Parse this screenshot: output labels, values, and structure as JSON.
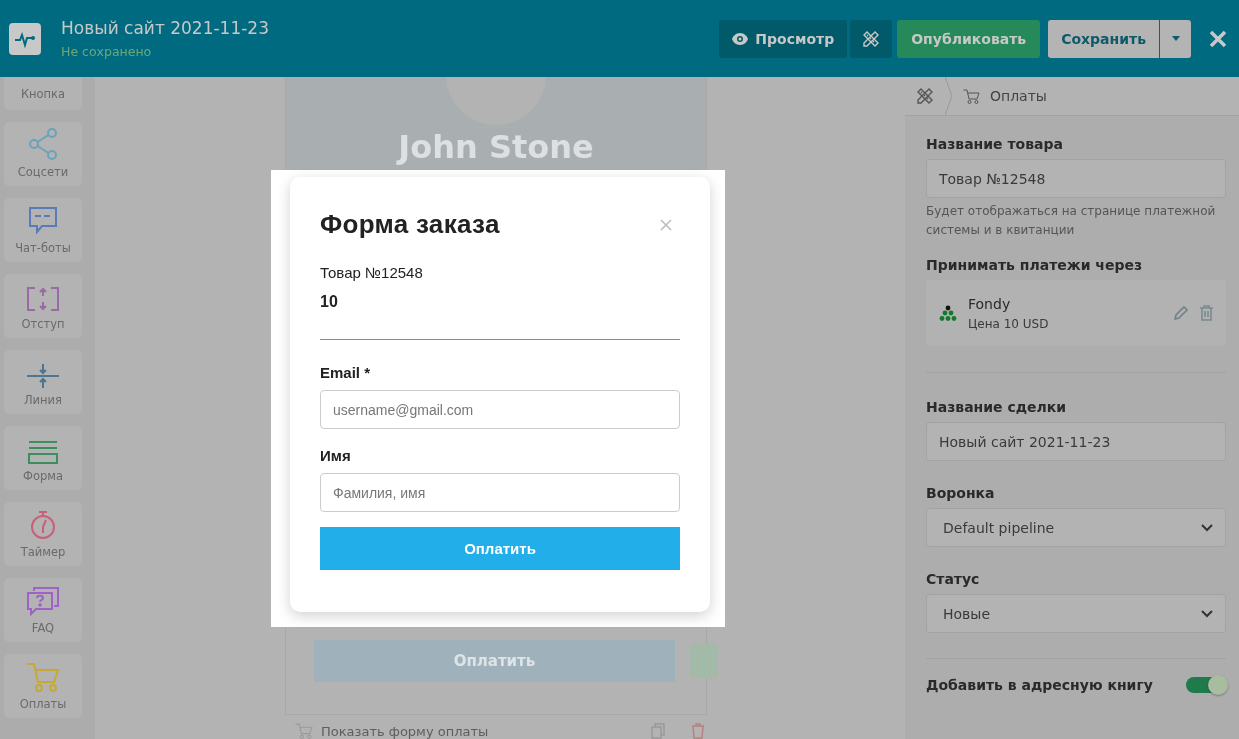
{
  "header": {
    "title": "Новый сайт 2021-11-23",
    "status": "Не сохранено",
    "buttons": [
      {
        "kind": "preview",
        "label": "Просмотр"
      },
      {
        "kind": "tools"
      },
      {
        "kind": "publish",
        "label": "Опубликовать"
      },
      {
        "kind": "save",
        "label": "Сохранить"
      },
      {
        "kind": "caret"
      },
      {
        "kind": "close"
      }
    ]
  },
  "sidebar": {
    "items": [
      {
        "label": "Кнопка"
      },
      {
        "label": "Соцсети",
        "kind": "share",
        "color": "#6aa3b8"
      },
      {
        "label": "Чат-боты",
        "kind": "chat",
        "color": "#5a7bb8"
      },
      {
        "label": "Отступ",
        "kind": "spacing",
        "color": "#9a6aa6"
      },
      {
        "label": "Линия",
        "kind": "line",
        "color": "#4f7590"
      },
      {
        "label": "Форма",
        "kind": "form",
        "color": "#3a8f5c"
      },
      {
        "label": "Таймер",
        "kind": "timer",
        "color": "#c8607a"
      },
      {
        "label": "FAQ",
        "kind": "faq",
        "color": "#9e62c8"
      },
      {
        "label": "Оплаты",
        "kind": "cart",
        "color": "#c8a834"
      }
    ]
  },
  "canvas": {
    "name": "John Stone",
    "button": "Оплатить",
    "footer": "Показать форму оплаты"
  },
  "modal": {
    "title": "Форма заказа",
    "product": "Товар №12548",
    "price": "10",
    "fields": [
      {
        "label": "Email *",
        "placeholder": "username@gmail.com"
      },
      {
        "label": "Имя",
        "placeholder": "Фамилия, имя"
      }
    ],
    "submit": "Оплатить"
  },
  "panel": {
    "breadcrumb": "Оплаты",
    "product_label": "Название товара",
    "product_value": "Товар №12548",
    "product_hint": "Будет отображаться на странице платежной системы и в квитанции",
    "gateway_label": "Принимать платежи через",
    "gateway": {
      "name": "Fondy",
      "price": "Цена 10 USD"
    },
    "deal_label": "Название сделки",
    "deal_value": "Новый сайт 2021-11-23",
    "funnel_label": "Воронка",
    "funnel_value": "Default pipeline",
    "status_label": "Статус",
    "status_value": "Новые",
    "address_book": {
      "label": "Добавить в адресную книгу",
      "on": true
    }
  }
}
